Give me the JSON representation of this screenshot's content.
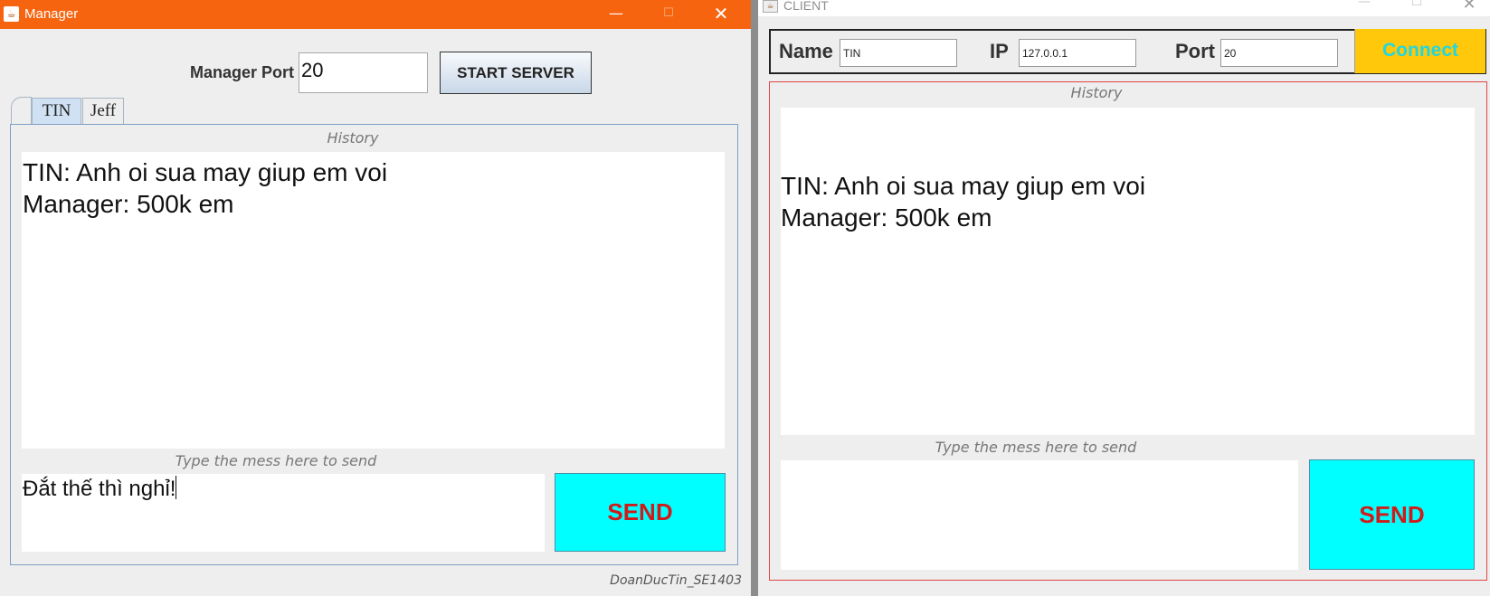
{
  "manager": {
    "title": "Manager",
    "window_controls": {
      "minimize": "—",
      "maximize": "☐",
      "close": "✕"
    },
    "port_label": "Manager Port",
    "port_value": "20",
    "start_button": "START SERVER",
    "tabs": [
      {
        "label": ""
      },
      {
        "label": "TIN",
        "selected": true
      },
      {
        "label": "Jeff"
      }
    ],
    "history_caption": "History",
    "history_lines": [
      "TIN: Anh oi sua may giup em voi",
      "Manager: 500k em"
    ],
    "type_caption": "Type the mess here to send",
    "message_input": "Đắt thế thì nghỉ!",
    "send_button": "SEND",
    "footer": "DoanDucTin_SE1403"
  },
  "client": {
    "title": "CLIENT",
    "window_controls": {
      "minimize": "—",
      "maximize": "☐",
      "close": "✕"
    },
    "name_label": "Name",
    "name_value": "TIN",
    "ip_label": "IP",
    "ip_value": "127.0.0.1",
    "port_label": "Port",
    "port_value": "20",
    "connect_button": "Connect",
    "history_caption": "History",
    "history_lines": [
      "TIN: Anh oi sua may giup em voi",
      "Manager: 500k em"
    ],
    "type_caption": "Type the mess here to send",
    "message_input": "",
    "send_button": "SEND"
  },
  "colors": {
    "manager_titlebar": "#f76410",
    "send_button_bg": "#00ffff",
    "send_button_text": "#d11a1a",
    "connect_button_bg": "#ffc80a",
    "connect_button_text": "#22d6e0",
    "tab_selected": "#cfe1f3",
    "client_panel_border": "#e24444"
  },
  "icons": {
    "app_icon": "java-coffee-cup-icon"
  }
}
